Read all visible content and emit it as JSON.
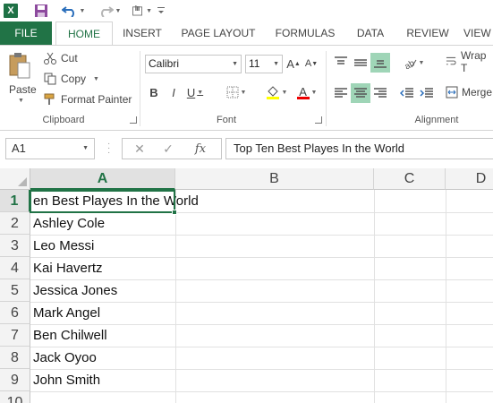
{
  "qat": {
    "logo_text": "X",
    "undo_icon": "undo-arrow",
    "redo_icon": "redo-arrow"
  },
  "tabs": {
    "file": "FILE",
    "home": "HOME",
    "insert": "INSERT",
    "page_layout": "PAGE LAYOUT",
    "formulas": "FORMULAS",
    "data": "DATA",
    "review": "REVIEW",
    "view": "VIEW"
  },
  "ribbon": {
    "clipboard": {
      "paste": "Paste",
      "cut": "Cut",
      "copy": "Copy",
      "format_painter": "Format Painter",
      "group_label": "Clipboard"
    },
    "font": {
      "font_name": "Calibri",
      "font_size": "11",
      "bold": "B",
      "italic": "I",
      "underline": "U",
      "grow": "A",
      "shrink": "A",
      "font_color_letter": "A",
      "group_label": "Font"
    },
    "alignment": {
      "wrap_text": "Wrap T",
      "merge": "Merge",
      "group_label": "Alignment"
    }
  },
  "formula_bar": {
    "name_box": "A1",
    "fx": "fx",
    "content": "Top Ten Best Playes In the World"
  },
  "grid": {
    "columns": [
      "A",
      "B",
      "C",
      "D"
    ],
    "rows": [
      "1",
      "2",
      "3",
      "4",
      "5",
      "6",
      "7",
      "8",
      "9",
      "10"
    ],
    "a1_visible": "en Best Playes In the World",
    "cells": [
      "Ashley Cole",
      "Leo Messi",
      "Kai Havertz",
      "Jessica Jones",
      "Mark Angel",
      "Ben Chilwell",
      "Jack Oyoo",
      "John Smith"
    ]
  },
  "colors": {
    "accent": "#217346",
    "selected_button": "#9fd5b7"
  }
}
